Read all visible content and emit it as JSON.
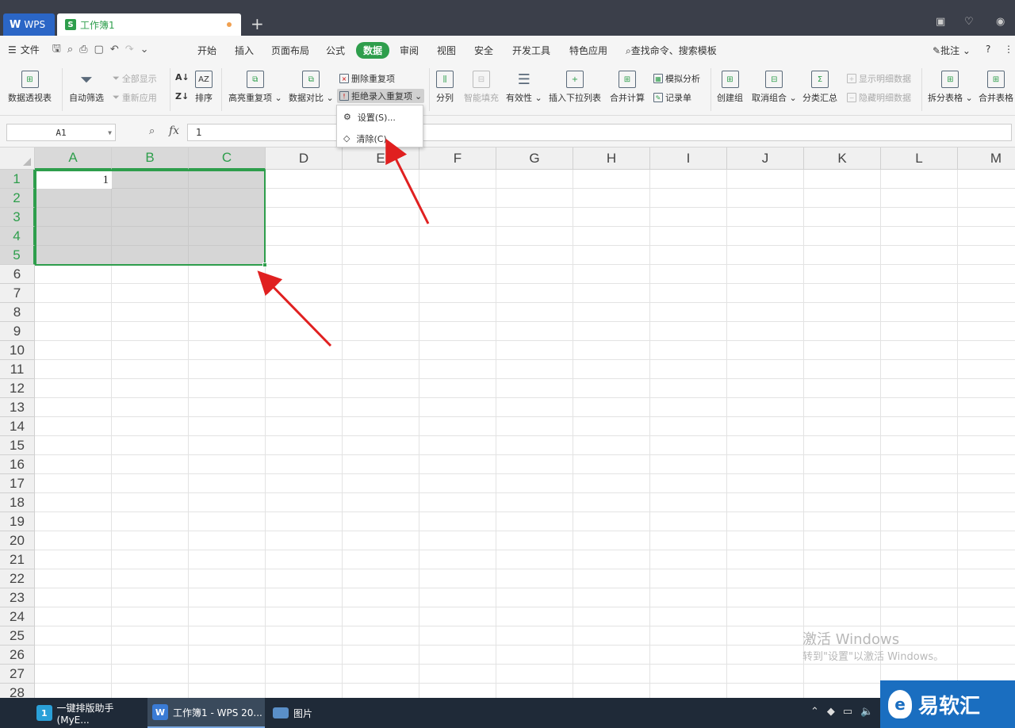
{
  "titlebar": {
    "wps_tab": "WPS",
    "doc_tab": "工作簿1",
    "add_tab": "+"
  },
  "menubar": {
    "file": "文件",
    "items": [
      "开始",
      "插入",
      "页面布局",
      "公式",
      "数据",
      "审阅",
      "视图",
      "安全",
      "开发工具",
      "特色应用"
    ],
    "active": "数据",
    "search": "查找命令、搜索模板",
    "annotate": "批注",
    "help": "?"
  },
  "ribbon": {
    "pivot": "数据透视表",
    "autofilter": "自动筛选",
    "show_all": "全部显示",
    "reapply": "重新应用",
    "sort": "排序",
    "highlight_dup": "高亮重复项",
    "data_compare": "数据对比",
    "delete_dup": "删除重复项",
    "reject_dup": "拒绝录入重复项",
    "split_col": "分列",
    "smart_fill": "智能填充",
    "validity": "有效性",
    "insert_dropdown": "插入下拉列表",
    "consolidate": "合并计算",
    "simulate": "模拟分析",
    "record": "记录单",
    "create_group": "创建组",
    "ungroup": "取消组合",
    "subtotal": "分类汇总",
    "show_detail": "显示明细数据",
    "hide_detail": "隐藏明细数据",
    "split_table": "拆分表格",
    "merge_table": "合并表格"
  },
  "dropdown": {
    "settings": "设置(S)...",
    "clear": "清除(C)"
  },
  "formulabar": {
    "name_box": "A1",
    "fx": "fx",
    "value": "1"
  },
  "grid": {
    "columns": [
      "A",
      "B",
      "C",
      "D",
      "E",
      "F",
      "G",
      "H",
      "I",
      "J",
      "K",
      "L",
      "M"
    ],
    "rows": [
      "1",
      "2",
      "3",
      "4",
      "5",
      "6",
      "7",
      "8",
      "9",
      "10",
      "11",
      "12",
      "13",
      "14",
      "15",
      "16",
      "17",
      "18",
      "19",
      "20",
      "21",
      "22",
      "23",
      "24",
      "25",
      "26",
      "27",
      "28"
    ],
    "a1_value": "1"
  },
  "watermark": {
    "line1": "激活 Windows",
    "line2": "转到\"设置\"以激活 Windows。"
  },
  "taskbar": {
    "apps": [
      "一键排版助手(MyE...",
      "工作簿1 - WPS 20...",
      "图片"
    ]
  },
  "brand": "易软汇",
  "colors": {
    "accent_green": "#2e9e4c",
    "annotation_red": "#e02020",
    "titlebar": "#3b3f4a"
  }
}
